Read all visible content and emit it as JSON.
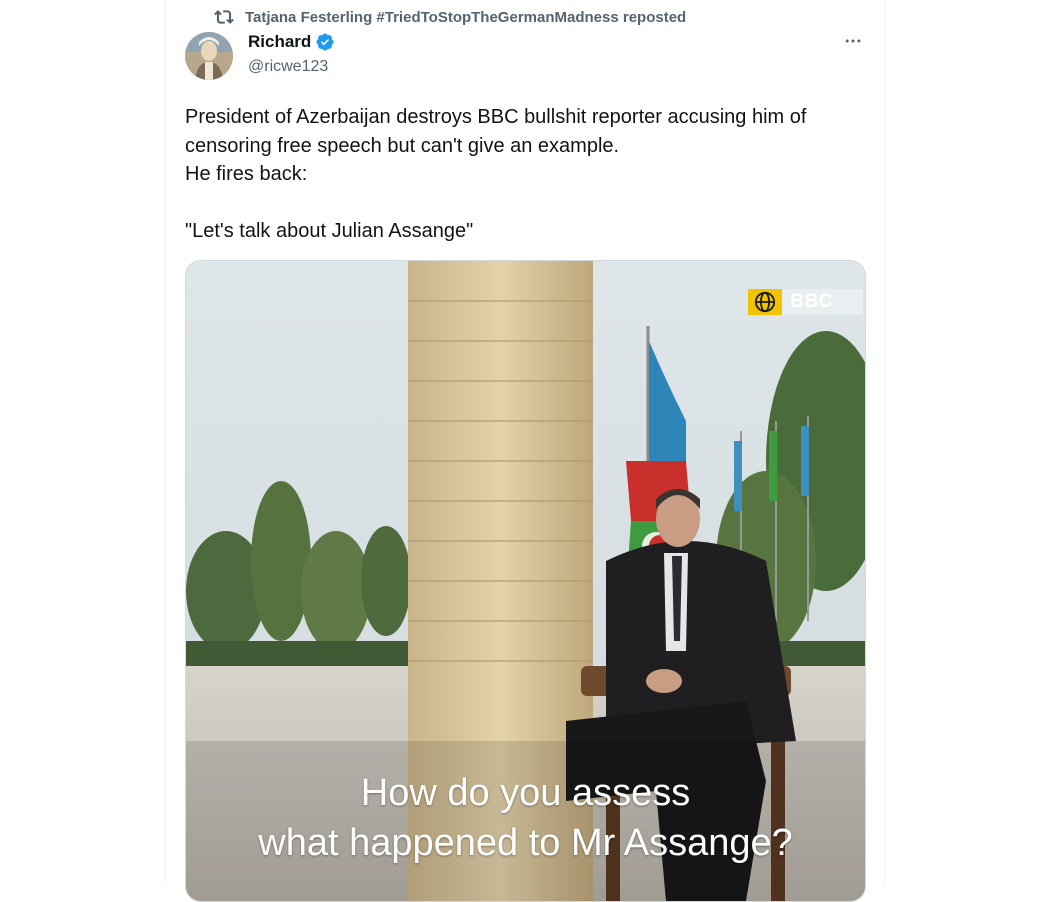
{
  "repost": {
    "icon": "repost-icon",
    "reposter": "Tatjana Festerling #TriedToStopTheGermanMadness",
    "verb": "reposted"
  },
  "author": {
    "name": "Richard",
    "handle": "@ricwe123",
    "verified": true,
    "verified_color": "#1d9bf0"
  },
  "more_icon": "more-horizontal-icon",
  "tweet": {
    "line1": "President of Azerbaijan destroys BBC bullshit reporter accusing him of",
    "line2": "censoring free speech but can't give an example.",
    "line3": "He fires back:",
    "line4": "\"Let's talk about Julian Assange\""
  },
  "media": {
    "watermark": "BBC",
    "watermark_icon": "globe-icon",
    "brand_color": "#f2c300",
    "caption_line1": "How do you assess",
    "caption_line2": "what happened to Mr Assange?"
  },
  "colors": {
    "text_primary": "#0f1419",
    "text_secondary": "#536471",
    "border": "#cfd9de"
  }
}
